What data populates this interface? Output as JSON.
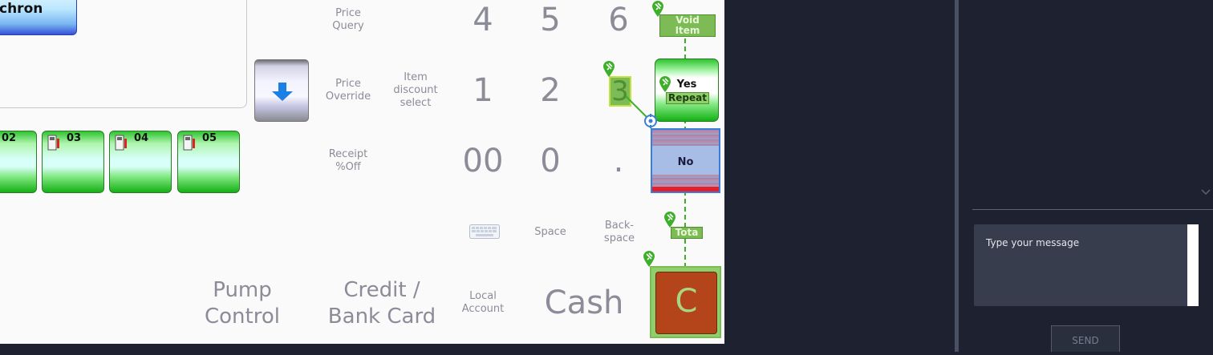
{
  "pos": {
    "customer_button_label": "chron",
    "pumps": [
      "02",
      "03",
      "04",
      "05"
    ],
    "functions": {
      "price_query": "Price\nQuery",
      "price_override": "Price\nOverride",
      "item_discount_select": "Item\ndiscount\nselect",
      "receipt_off": "Receipt\n%Off",
      "space": "Space",
      "backspace": "Back-\nspace"
    },
    "keypad": {
      "row1": [
        "4",
        "5",
        "6"
      ],
      "row2": [
        "1",
        "2",
        "3"
      ],
      "row3": [
        "00",
        "0",
        "."
      ]
    },
    "side_buttons": {
      "void_item": "Void Item",
      "yes": "Yes",
      "repeat": "Repeat",
      "no": "No",
      "total": "Tota",
      "clear": "C"
    },
    "bottom": {
      "pump_control": "Pump\nControl",
      "credit_card": "Credit /\nBank Card",
      "local_account": "Local\nAccount",
      "cash": "Cash"
    }
  },
  "chat": {
    "input_placeholder": "Type your message",
    "send_label": "SEND"
  },
  "colors": {
    "pos_bg": "#fafafa",
    "chat_bg": "#1e2230",
    "tile_green": "#2fc42f",
    "clear_button": "#b4441a",
    "annotation_green": "#3fae2a"
  }
}
